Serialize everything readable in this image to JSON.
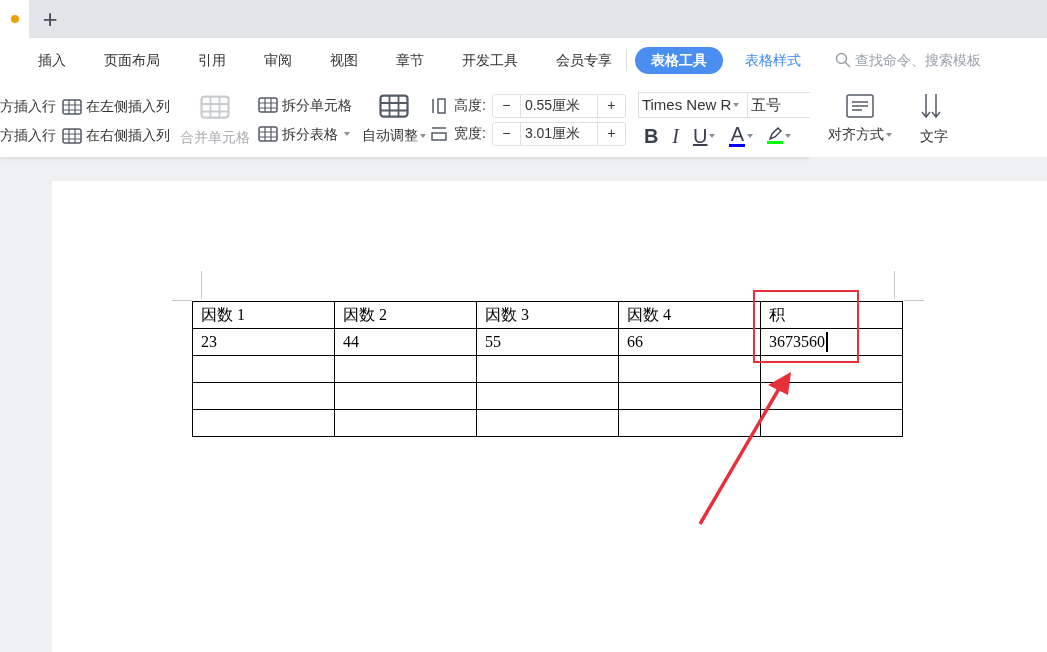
{
  "tab_bar": {
    "tabs": [
      {
        "modified": true
      }
    ],
    "new_tab": "+"
  },
  "menu": {
    "items": [
      {
        "label": "插入",
        "kind": "normal",
        "selected": false
      },
      {
        "label": "页面布局",
        "kind": "normal",
        "selected": false
      },
      {
        "label": "引用",
        "kind": "normal",
        "selected": false
      },
      {
        "label": "审阅",
        "kind": "normal",
        "selected": false
      },
      {
        "label": "视图",
        "kind": "normal",
        "selected": false
      },
      {
        "label": "章节",
        "kind": "normal",
        "selected": false
      },
      {
        "label": "开发工具",
        "kind": "normal",
        "selected": false
      },
      {
        "label": "会员专享",
        "kind": "normal",
        "selected": false
      },
      {
        "label": "表格工具",
        "kind": "context",
        "selected": true
      },
      {
        "label": "表格样式",
        "kind": "context",
        "selected": false
      }
    ],
    "search": {
      "placeholder": "查找命令、搜索模板"
    }
  },
  "ribbon": {
    "insert": [
      {
        "label": "方插入行",
        "kind": "row"
      },
      {
        "label": "在左侧插入列",
        "kind": "col"
      },
      {
        "label": "方插入行",
        "kind": "row"
      },
      {
        "label": "在右侧插入列",
        "kind": "col"
      }
    ],
    "merge": {
      "label": "合并单元格",
      "disabled": true
    },
    "split": [
      {
        "label": "拆分单元格",
        "has_menu": false
      },
      {
        "label": "拆分表格",
        "has_menu": true
      }
    ],
    "autofit": {
      "label": "自动调整"
    },
    "sizes": [
      {
        "label": "高度:",
        "kind": "height",
        "minus": "−",
        "value": "0.55厘米",
        "plus": "+"
      },
      {
        "label": "宽度:",
        "kind": "width",
        "minus": "−",
        "value": "3.01厘米",
        "plus": "+"
      }
    ],
    "font": {
      "name": "Times New R",
      "size": "五号",
      "bold": "B",
      "italic": "I",
      "underline": "U",
      "font_color": {
        "label": "A",
        "color": "#0000ff"
      },
      "highlight": {
        "color": "#00ff00"
      }
    },
    "align": {
      "label": "对齐方式"
    },
    "text_direction": {
      "label": "文字"
    }
  },
  "table": {
    "header": [
      "因数 1",
      "因数 2",
      "因数 3",
      "因数 4",
      "积"
    ],
    "rows": [
      {
        "cells": [
          {
            "text": "23",
            "caret": false
          },
          {
            "text": "44",
            "caret": false
          },
          {
            "text": "55",
            "caret": false
          },
          {
            "text": "66",
            "caret": false
          },
          {
            "text": "3673560",
            "caret": true
          }
        ]
      },
      {
        "cells": [
          null,
          null,
          null,
          null,
          null
        ]
      },
      {
        "cells": [
          null,
          null,
          null,
          null,
          null
        ]
      },
      {
        "cells": [
          null,
          null,
          null,
          null,
          null
        ]
      }
    ]
  }
}
